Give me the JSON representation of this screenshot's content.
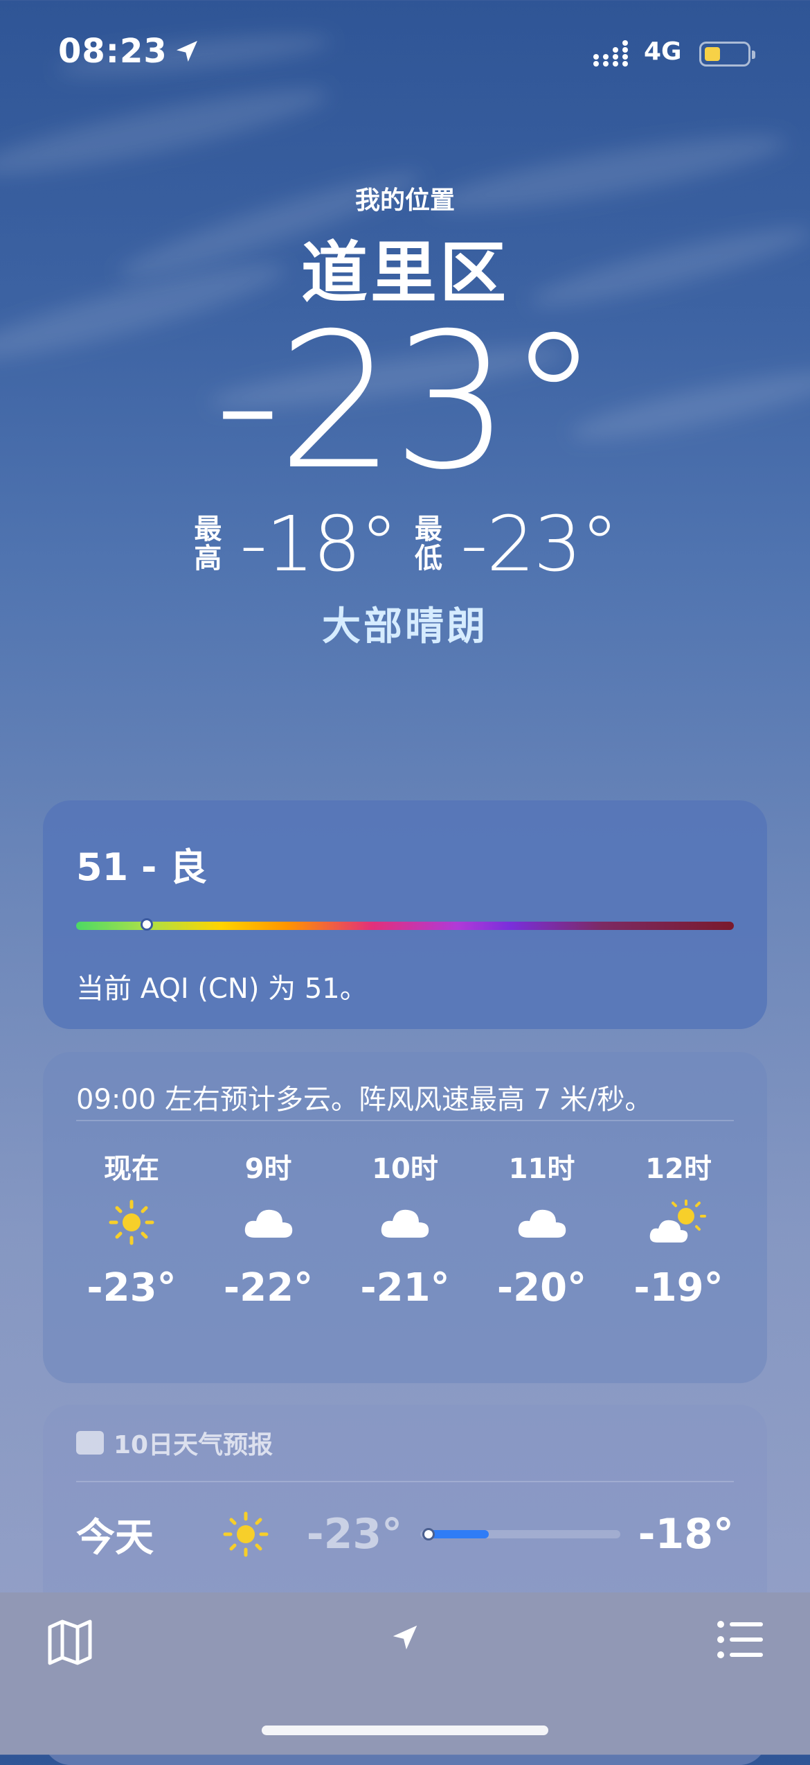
{
  "status_bar": {
    "time": "08:23",
    "network": "4G"
  },
  "header": {
    "subtitle": "我的位置",
    "city": "道里区",
    "temperature": "-23°",
    "high_label": "最高",
    "high": "-18°",
    "low_label": "最低",
    "low": "-23°",
    "condition": "大部晴朗"
  },
  "aqi": {
    "title": "51 - 良",
    "level_fraction": 0.107,
    "description": "当前 AQI (CN) 为 51。"
  },
  "hourly": {
    "summary": "09:00 左右预计多云。阵风风速最高 7 米/秒。",
    "items": [
      {
        "label": "现在",
        "icon": "sun-icon",
        "temp": "-23°"
      },
      {
        "label": "9时",
        "icon": "cloud-icon",
        "temp": "-22°"
      },
      {
        "label": "10时",
        "icon": "cloud-icon",
        "temp": "-21°"
      },
      {
        "label": "11时",
        "icon": "cloud-icon",
        "temp": "-20°"
      },
      {
        "label": "12时",
        "icon": "partly-sunny-icon",
        "temp": "-19°"
      }
    ]
  },
  "daily": {
    "title": "10日天气预报",
    "rows": [
      {
        "day": "今天",
        "icon": "sun-icon",
        "low": "-23°",
        "high": "-18°",
        "range_start": 0.02,
        "range_end": 0.33,
        "current": 0.02
      }
    ]
  },
  "toolbar": {
    "map_icon": "map-icon",
    "location_icon": "location-arrow-icon",
    "list_icon": "list-icon"
  },
  "colors": {
    "sun": "#f7cf2a",
    "condition": "#d6ecff",
    "range_fill": "#2f7cf6",
    "battery": "#f7d147"
  }
}
